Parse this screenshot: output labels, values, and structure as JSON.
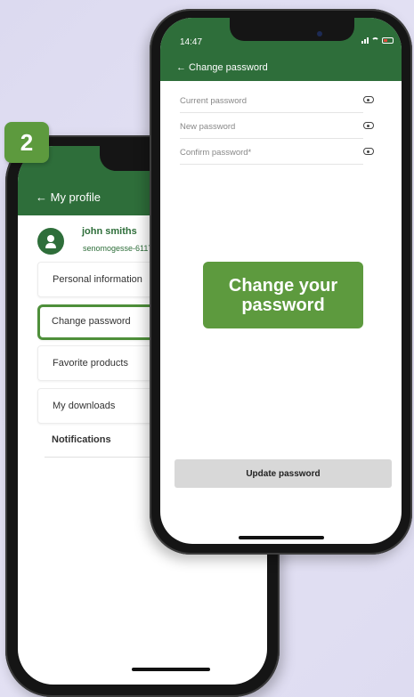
{
  "step_number": "2",
  "back_screen": {
    "title": "← My profile",
    "user_name": "john smiths",
    "user_email": "senomogesse-6117",
    "menu": [
      {
        "label": "Personal information"
      },
      {
        "label": "Change password"
      },
      {
        "label": "Favorite products"
      },
      {
        "label": "My downloads"
      }
    ],
    "notifications_label": "Notifications"
  },
  "front_screen": {
    "time": "14:47",
    "title": "← Change password",
    "fields": [
      {
        "placeholder": "Current password"
      },
      {
        "placeholder": "New password"
      },
      {
        "placeholder": "Confirm password*"
      }
    ],
    "callout": "Change your\npassword",
    "update_button": "Update password"
  },
  "colors": {
    "header_green": "#2e6e3a",
    "accent_green": "#5d9a3e"
  }
}
